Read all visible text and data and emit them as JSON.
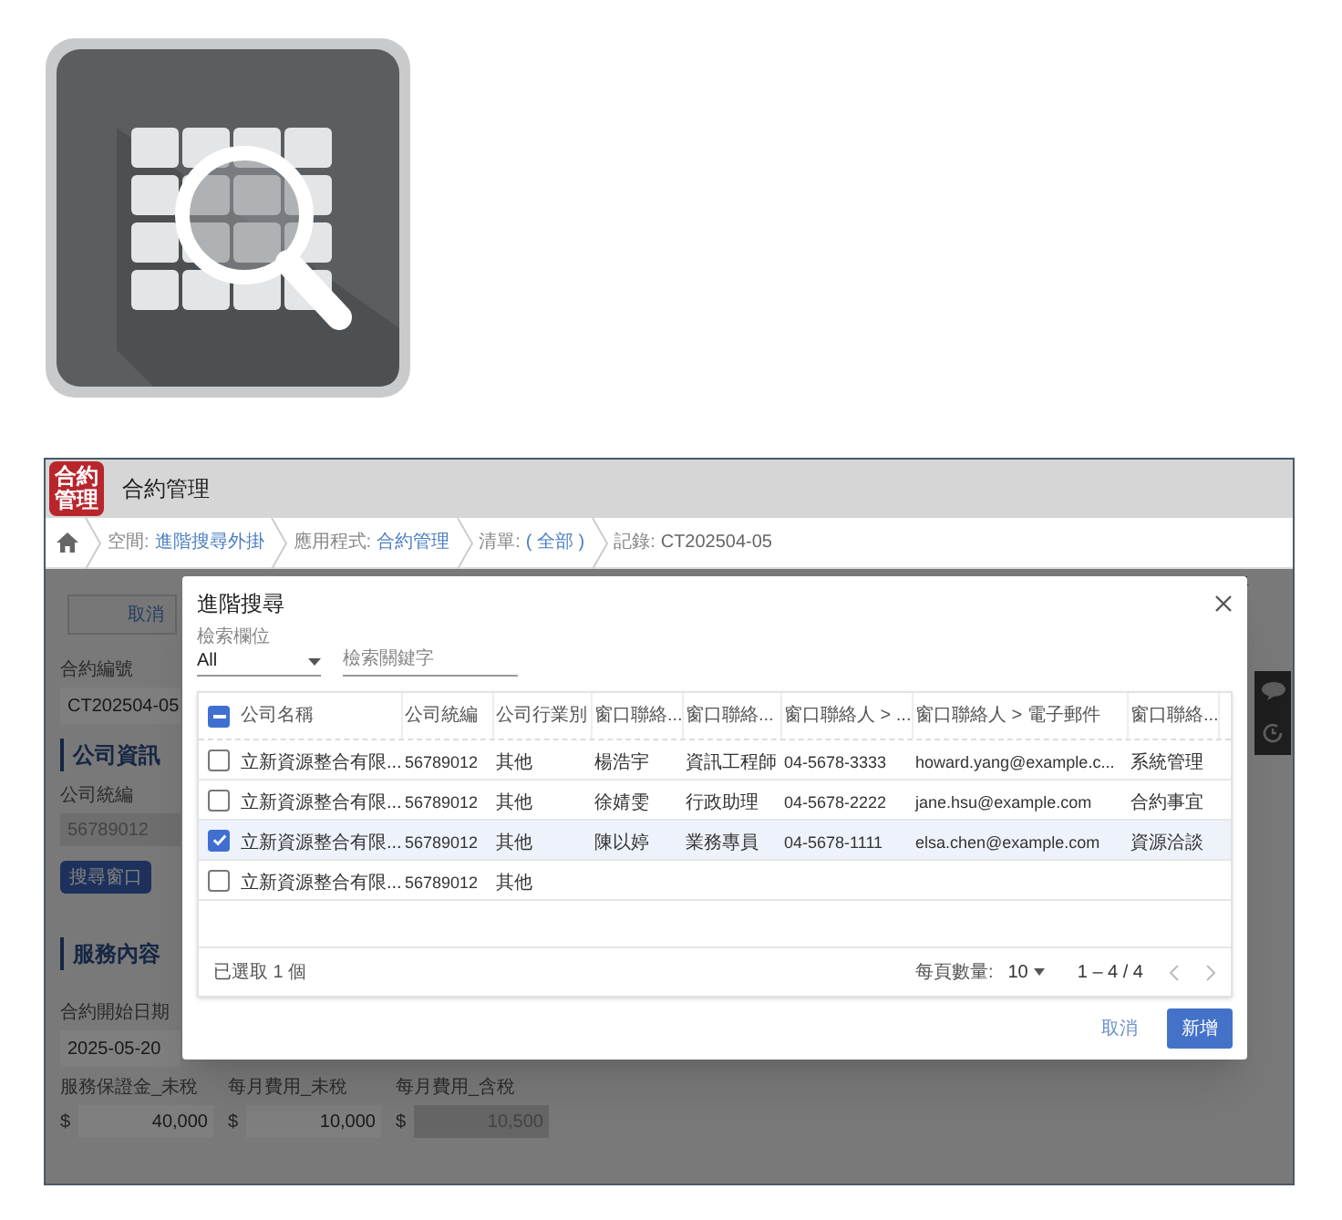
{
  "header": {
    "logo_lines": [
      "合約",
      "管理"
    ],
    "title": "合約管理"
  },
  "breadcrumb": [
    {
      "label": "空間:",
      "value": "進階搜尋外掛",
      "link": true
    },
    {
      "label": "應用程式:",
      "value": "合約管理",
      "link": true
    },
    {
      "label": "清單:",
      "value": "( 全部 )",
      "link": true
    },
    {
      "label": "記錄:",
      "value": "CT202504-05",
      "link": false
    }
  ],
  "form": {
    "cancel_button": "取消",
    "contract_no_label": "合約編號",
    "contract_no": "CT202504-05",
    "section_company": "公司資訊",
    "tax_id_label": "公司統編",
    "tax_id": "56789012",
    "search_button": "搜尋窗口",
    "section_service": "服務內容",
    "start_date_label": "合約開始日期",
    "start_date": "2025-05-20",
    "amounts": [
      {
        "label": "服務保證金_未稅",
        "currency": "$",
        "value": "40,000",
        "disabled": false
      },
      {
        "label": "每月費用_未稅",
        "currency": "$",
        "value": "10,000",
        "disabled": false
      },
      {
        "label": "每月費用_含稅",
        "currency": "$",
        "value": "10,500",
        "disabled": true
      }
    ]
  },
  "dialog": {
    "title": "進階搜尋",
    "field_label": "檢索欄位",
    "field_value": "All",
    "search_placeholder": "檢索關鍵字",
    "select_all_partial": true,
    "columns": [
      "公司名稱",
      "公司統編",
      "公司行業別",
      "窗口聯絡...",
      "窗口聯絡...",
      "窗口聯絡人 > ...",
      "窗口聯絡人 > 電子郵件",
      "窗口聯絡..."
    ],
    "rows": [
      {
        "selected": false,
        "cells": [
          "立新資源整合有限...",
          "56789012",
          "其他",
          "楊浩宇",
          "資訊工程師",
          "04-5678-3333",
          "howard.yang@example.c...",
          "系統管理"
        ]
      },
      {
        "selected": false,
        "cells": [
          "立新資源整合有限...",
          "56789012",
          "其他",
          "徐婧雯",
          "行政助理",
          "04-5678-2222",
          "jane.hsu@example.com",
          "合約事宜"
        ]
      },
      {
        "selected": true,
        "cells": [
          "立新資源整合有限...",
          "56789012",
          "其他",
          "陳以婷",
          "業務專員",
          "04-5678-1111",
          "elsa.chen@example.com",
          "資源洽談"
        ]
      },
      {
        "selected": false,
        "cells": [
          "立新資源整合有限...",
          "56789012",
          "其他"
        ]
      }
    ],
    "selected_count": "已選取 1 個",
    "rows_per_page_label": "每頁數量:",
    "rows_per_page": "10",
    "range": "1 – 4 / 4",
    "cancel_button": "取消",
    "add_button": "新增"
  }
}
